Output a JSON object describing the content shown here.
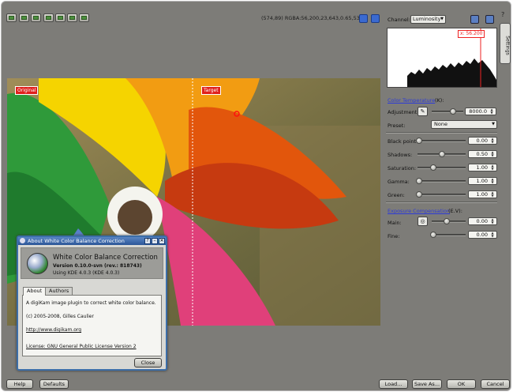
{
  "toolbar": {
    "icons": [
      "original-view-icon",
      "split-horizontal-icon",
      "split-vertical-icon",
      "overlay-icon",
      "compare-icon",
      "split-duplicate-icon",
      "preview-icon"
    ],
    "pixel_info": "(574,89) RGBA:56,200,23,643,0.65,535"
  },
  "image": {
    "original_label": "Original",
    "target_label": "Target"
  },
  "settings_tab": "Settings",
  "panel": {
    "channel_label": "Channel:",
    "channel_value": "Luminosity",
    "histogram_marker": "x: 56.200",
    "color_temperature_link": "Color Temperature",
    "color_temperature_unit": "(K):",
    "adjustment_label": "Adjustment:",
    "adjustment_value": "8000.0",
    "preset_label": "Preset:",
    "preset_value": "None",
    "black_point_label": "Black point:",
    "black_point_value": "0.00",
    "shadows_label": "Shadows:",
    "shadows_value": "0.50",
    "saturation_label": "Saturation:",
    "saturation_value": "1.00",
    "gamma_label": "Gamma:",
    "gamma_value": "1.00",
    "green_label": "Green:",
    "green_value": "1.00",
    "exposure_link": "Exposure Compensation",
    "exposure_unit": "(E.V):",
    "main_label": "Main:",
    "main_value": "0.00",
    "fine_label": "Fine:",
    "fine_value": "0.00"
  },
  "slider_levels": {
    "adjustment": 0.67,
    "black_point": 0.0,
    "shadows": 0.5,
    "saturation": 0.33,
    "gamma": 0.0,
    "green": 0.0,
    "main": 0.45,
    "fine": 0.0
  },
  "dialog": {
    "title": "About White Color Balance Correction",
    "heading": "White Color Balance Correction",
    "version": "Version 0.10.0-svn (rev.: 818743)",
    "using": "Using KDE 4.0.3 (KDE 4.0.3)",
    "tab_about": "About",
    "tab_authors": "Authors",
    "description": "A digiKam image plugin to correct white color balance.",
    "copyright": "(c) 2005-2008, Gilles Caulier",
    "url": "http://www.digikam.org",
    "license": "License: GNU General Public License Version 2",
    "close_label": "Close",
    "help_glyph": "?",
    "min_glyph": "–",
    "close_glyph": "✕"
  },
  "footer": {
    "help": "Help",
    "defaults": "Defaults",
    "load": "Load...",
    "save_as": "Save As...",
    "ok": "OK",
    "cancel": "Cancel"
  },
  "corner_help": "?"
}
